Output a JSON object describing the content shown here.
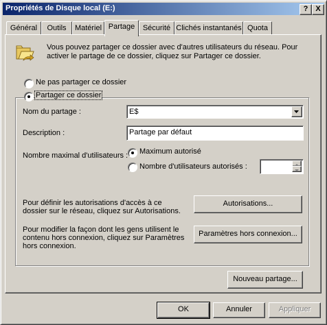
{
  "window": {
    "title": "Propriétés de Disque local (E:)",
    "help_btn": "?",
    "close_btn": "X"
  },
  "tabs": [
    {
      "label": "Général"
    },
    {
      "label": "Outils"
    },
    {
      "label": "Matériel"
    },
    {
      "label": "Partage"
    },
    {
      "label": "Sécurité"
    },
    {
      "label": "Clichés instantanés"
    },
    {
      "label": "Quota"
    }
  ],
  "sharing": {
    "intro": [
      "Vous pouvez partager ce dossier avec d'autres utilisateurs du réseau. Pour",
      "activer le partage de ce dossier, cliquez sur Partager ce dossier."
    ],
    "no_share_label": "Ne pas partager ce dossier",
    "share_label": "Partager ce dossier",
    "share_name_label": "Nom du partage :",
    "share_name_value": "E$",
    "description_label": "Description :",
    "description_value": "Partage par défaut",
    "max_users_label": "Nombre maximal d'utilisateurs :",
    "max_allowed_label": "Maximum autorisé",
    "num_users_label": "Nombre d'utilisateurs autorisés :",
    "num_users_value": "",
    "permissions_text": [
      "Pour définir les autorisations d'accès à ce",
      "dossier sur le réseau, cliquez sur Autorisations."
    ],
    "permissions_button": "Autorisations...",
    "offline_text": [
      "Pour modifier la façon dont les gens utilisent le",
      "contenu hors connexion, cliquez sur Paramètres",
      "hors connexion."
    ],
    "offline_button": "Paramètres hors connexion...",
    "new_share_button": "Nouveau partage..."
  },
  "footer": {
    "ok": "OK",
    "cancel": "Annuler",
    "apply": "Appliquer"
  }
}
